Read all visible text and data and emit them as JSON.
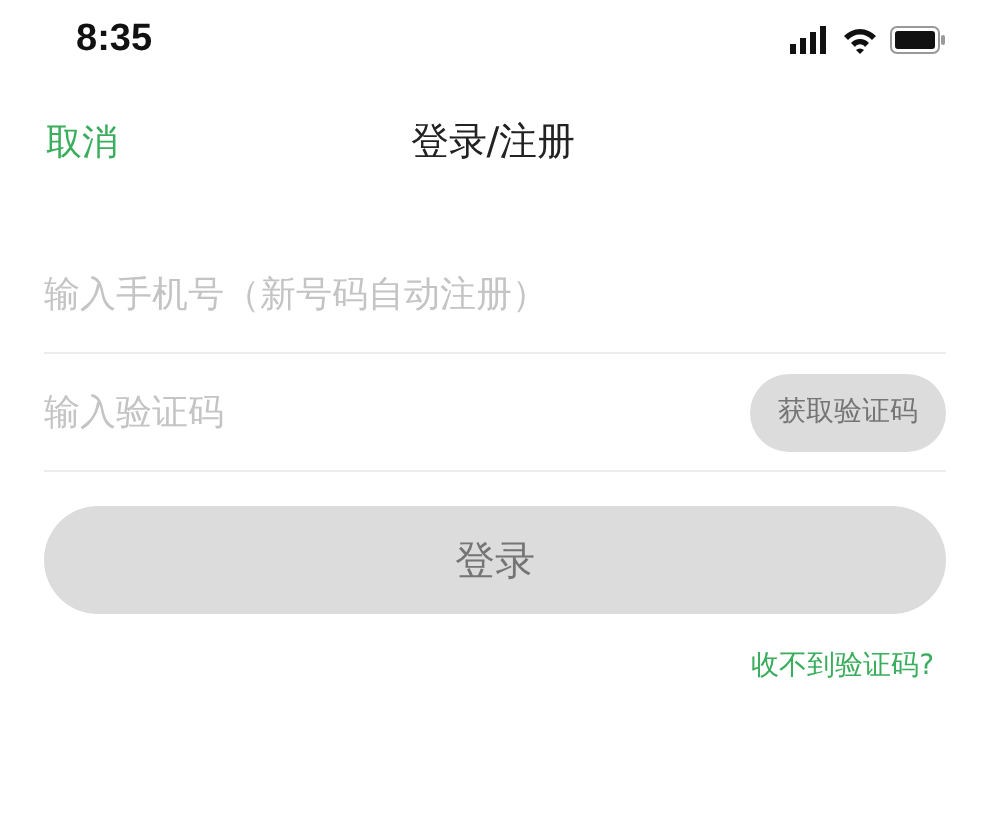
{
  "status_bar": {
    "time": "8:35"
  },
  "nav": {
    "cancel": "取消",
    "title": "登录/注册"
  },
  "phone_field": {
    "placeholder": "输入手机号（新号码自动注册）"
  },
  "code_field": {
    "placeholder": "输入验证码",
    "send_button": {
      "label": "获取验证码",
      "disabled": true
    }
  },
  "login_button": {
    "label": "登录",
    "disabled": true
  },
  "help_link": "收不到验证码?"
}
